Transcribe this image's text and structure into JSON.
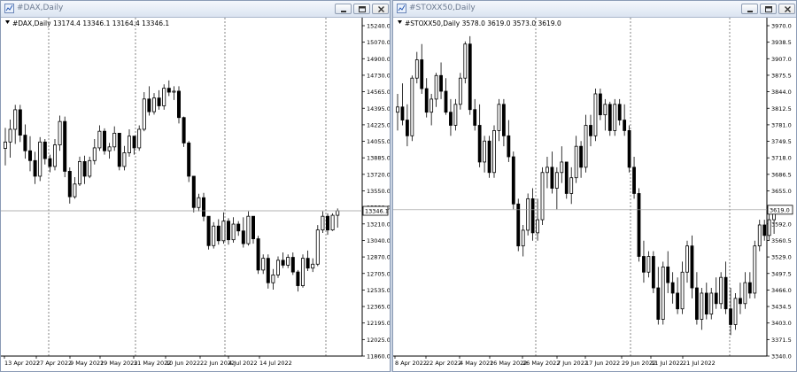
{
  "windows": [
    {
      "title": "#DAX,Daily",
      "info": "#DAX,Daily  13174.4 13346.1 13164.4 13346.1",
      "current_price": "13346.1",
      "y_ticks": [
        "15240.0",
        "15070.0",
        "14900.0",
        "14730.0",
        "14565.0",
        "14395.0",
        "14225.0",
        "14055.0",
        "13885.0",
        "13720.0",
        "13550.0",
        "13380.0",
        "13210.0",
        "13040.0",
        "12870.0",
        "12705.0",
        "12535.0",
        "12365.0",
        "12195.0",
        "12025.0",
        "11860.0"
      ],
      "x_ticks": [
        "13 Apr 2022",
        "27 Apr 2022",
        "9 May 2022",
        "19 May 2022",
        "31 May 2022",
        "10 Jun 2022",
        "22 Jun 2022",
        "4 Jul 2022",
        "14 Jul 2022"
      ]
    },
    {
      "title": "#STOXX50,Daily",
      "info": "#STOXX50,Daily  3578.0 3619.0 3573.0 3619.0",
      "current_price": "3619.0",
      "y_ticks": [
        "3970.0",
        "3938.5",
        "3907.0",
        "3875.5",
        "3844.0",
        "3812.5",
        "3781.0",
        "3749.5",
        "3718.0",
        "3686.5",
        "3655.0",
        "3623.5",
        "3592.0",
        "3560.5",
        "3529.0",
        "3497.5",
        "3466.0",
        "3434.5",
        "3403.0",
        "3371.5",
        "3340.0"
      ],
      "x_ticks": [
        "8 Apr 2022",
        "22 Apr 2022",
        "4 May 2022",
        "16 May 2022",
        "26 May 2022",
        "7 Jun 2022",
        "17 Jun 2022",
        "29 Jun 2022",
        "11 Jul 2022",
        "21 Jul 2022"
      ]
    }
  ],
  "chart_data": [
    {
      "type": "candlestick",
      "title": "#DAX,Daily",
      "ylim": [
        11860,
        15240
      ],
      "ohlc": [
        [
          13985,
          14195,
          13810,
          14050
        ],
        [
          14050,
          14280,
          13890,
          14180
        ],
        [
          14180,
          14430,
          14030,
          14380
        ],
        [
          14380,
          14430,
          14050,
          14120
        ],
        [
          14120,
          14230,
          13880,
          13960
        ],
        [
          13960,
          14110,
          13750,
          13860
        ],
        [
          13860,
          13950,
          13620,
          13700
        ],
        [
          13700,
          14100,
          13650,
          14050
        ],
        [
          14050,
          14080,
          13820,
          13880
        ],
        [
          13880,
          13920,
          13740,
          13800
        ],
        [
          13800,
          14080,
          13760,
          14020
        ],
        [
          14020,
          14320,
          13960,
          14260
        ],
        [
          14260,
          14310,
          13690,
          13750
        ],
        [
          13750,
          13790,
          13420,
          13490
        ],
        [
          13490,
          13690,
          13470,
          13620
        ],
        [
          13620,
          13900,
          13600,
          13850
        ],
        [
          13850,
          13910,
          13620,
          13700
        ],
        [
          13700,
          13900,
          13680,
          13860
        ],
        [
          13860,
          14080,
          13820,
          13990
        ],
        [
          13990,
          14220,
          13960,
          14160
        ],
        [
          14160,
          14190,
          13920,
          13960
        ],
        [
          13960,
          14040,
          13880,
          14000
        ],
        [
          14000,
          14210,
          13960,
          14140
        ],
        [
          14140,
          14060,
          13760,
          13800
        ],
        [
          13800,
          14010,
          13760,
          13940
        ],
        [
          13940,
          14180,
          13900,
          14110
        ],
        [
          14110,
          14080,
          13920,
          13990
        ],
        [
          13990,
          14220,
          13960,
          14180
        ],
        [
          14180,
          14560,
          14160,
          14490
        ],
        [
          14490,
          14620,
          14320,
          14360
        ],
        [
          14360,
          14550,
          14330,
          14500
        ],
        [
          14500,
          14580,
          14380,
          14420
        ],
        [
          14420,
          14640,
          14380,
          14600
        ],
        [
          14600,
          14680,
          14520,
          14560
        ],
        [
          14560,
          14620,
          14480,
          14570
        ],
        [
          14570,
          14620,
          14240,
          14300
        ],
        [
          14300,
          14310,
          14000,
          14040
        ],
        [
          14040,
          14060,
          13640,
          13700
        ],
        [
          13700,
          13660,
          13330,
          13380
        ],
        [
          13380,
          13520,
          13340,
          13480
        ],
        [
          13480,
          13530,
          13240,
          13290
        ],
        [
          13290,
          13280,
          12950,
          12990
        ],
        [
          12990,
          13230,
          12960,
          13190
        ],
        [
          13190,
          13260,
          13000,
          13040
        ],
        [
          13040,
          13330,
          13010,
          13240
        ],
        [
          13240,
          13270,
          13000,
          13050
        ],
        [
          13050,
          13280,
          13020,
          13210
        ],
        [
          13210,
          13240,
          13090,
          13140
        ],
        [
          13140,
          13280,
          12970,
          13010
        ],
        [
          13010,
          13340,
          12990,
          13290
        ],
        [
          13290,
          13280,
          13010,
          13060
        ],
        [
          13060,
          13090,
          12700,
          12740
        ],
        [
          12740,
          12900,
          12700,
          12860
        ],
        [
          12860,
          12900,
          12550,
          12610
        ],
        [
          12610,
          12750,
          12540,
          12690
        ],
        [
          12690,
          12880,
          12660,
          12840
        ],
        [
          12840,
          12920,
          12760,
          12790
        ],
        [
          12790,
          12900,
          12760,
          12870
        ],
        [
          12870,
          12920,
          12690,
          12720
        ],
        [
          12720,
          12740,
          12520,
          12580
        ],
        [
          12580,
          12900,
          12560,
          12860
        ],
        [
          12860,
          12940,
          12730,
          12760
        ],
        [
          12760,
          12860,
          12720,
          12800
        ],
        [
          12800,
          13200,
          12780,
          13150
        ],
        [
          13150,
          13340,
          13120,
          13290
        ],
        [
          13290,
          13320,
          13100,
          13150
        ],
        [
          13150,
          13320,
          13140,
          13300
        ],
        [
          13300,
          13370,
          13174,
          13346
        ]
      ]
    },
    {
      "type": "candlestick",
      "title": "#STOXX50,Daily",
      "ylim": [
        3340,
        3970
      ],
      "ohlc": [
        [
          3805,
          3840,
          3770,
          3815
        ],
        [
          3815,
          3860,
          3780,
          3790
        ],
        [
          3790,
          3820,
          3740,
          3760
        ],
        [
          3760,
          3875,
          3750,
          3870
        ],
        [
          3870,
          3920,
          3860,
          3905
        ],
        [
          3905,
          3935,
          3840,
          3850
        ],
        [
          3850,
          3870,
          3795,
          3805
        ],
        [
          3805,
          3840,
          3780,
          3830
        ],
        [
          3830,
          3880,
          3815,
          3875
        ],
        [
          3875,
          3900,
          3830,
          3845
        ],
        [
          3845,
          3870,
          3800,
          3805
        ],
        [
          3805,
          3830,
          3760,
          3780
        ],
        [
          3780,
          3830,
          3770,
          3820
        ],
        [
          3820,
          3880,
          3810,
          3870
        ],
        [
          3870,
          3940,
          3860,
          3935
        ],
        [
          3935,
          3950,
          3800,
          3810
        ],
        [
          3810,
          3830,
          3770,
          3780
        ],
        [
          3780,
          3820,
          3700,
          3710
        ],
        [
          3710,
          3760,
          3690,
          3750
        ],
        [
          3750,
          3760,
          3680,
          3690
        ],
        [
          3690,
          3780,
          3680,
          3770
        ],
        [
          3770,
          3830,
          3750,
          3820
        ],
        [
          3820,
          3830,
          3740,
          3760
        ],
        [
          3760,
          3790,
          3710,
          3720
        ],
        [
          3720,
          3730,
          3620,
          3630
        ],
        [
          3630,
          3640,
          3540,
          3550
        ],
        [
          3550,
          3590,
          3530,
          3580
        ],
        [
          3580,
          3650,
          3570,
          3640
        ],
        [
          3640,
          3660,
          3560,
          3575
        ],
        [
          3575,
          3640,
          3560,
          3600
        ],
        [
          3600,
          3700,
          3590,
          3690
        ],
        [
          3690,
          3720,
          3660,
          3700
        ],
        [
          3700,
          3730,
          3650,
          3660
        ],
        [
          3660,
          3700,
          3620,
          3690
        ],
        [
          3690,
          3740,
          3670,
          3710
        ],
        [
          3710,
          3700,
          3640,
          3650
        ],
        [
          3650,
          3700,
          3630,
          3680
        ],
        [
          3680,
          3760,
          3670,
          3740
        ],
        [
          3740,
          3750,
          3680,
          3700
        ],
        [
          3700,
          3800,
          3690,
          3780
        ],
        [
          3780,
          3800,
          3740,
          3760
        ],
        [
          3760,
          3850,
          3750,
          3840
        ],
        [
          3840,
          3850,
          3790,
          3800
        ],
        [
          3800,
          3830,
          3770,
          3820
        ],
        [
          3820,
          3825,
          3760,
          3770
        ],
        [
          3770,
          3830,
          3760,
          3820
        ],
        [
          3820,
          3830,
          3780,
          3790
        ],
        [
          3790,
          3820,
          3760,
          3770
        ],
        [
          3770,
          3780,
          3690,
          3700
        ],
        [
          3700,
          3720,
          3640,
          3650
        ],
        [
          3650,
          3660,
          3520,
          3530
        ],
        [
          3530,
          3560,
          3480,
          3500
        ],
        [
          3500,
          3540,
          3490,
          3530
        ],
        [
          3530,
          3540,
          3460,
          3470
        ],
        [
          3470,
          3510,
          3400,
          3410
        ],
        [
          3410,
          3520,
          3400,
          3510
        ],
        [
          3510,
          3540,
          3460,
          3480
        ],
        [
          3480,
          3500,
          3440,
          3460
        ],
        [
          3460,
          3490,
          3420,
          3430
        ],
        [
          3430,
          3520,
          3420,
          3500
        ],
        [
          3500,
          3560,
          3480,
          3550
        ],
        [
          3550,
          3570,
          3450,
          3470
        ],
        [
          3470,
          3500,
          3400,
          3410
        ],
        [
          3410,
          3470,
          3390,
          3460
        ],
        [
          3460,
          3480,
          3410,
          3420
        ],
        [
          3420,
          3470,
          3410,
          3460
        ],
        [
          3460,
          3490,
          3430,
          3440
        ],
        [
          3440,
          3500,
          3430,
          3490
        ],
        [
          3490,
          3520,
          3420,
          3430
        ],
        [
          3430,
          3470,
          3380,
          3400
        ],
        [
          3400,
          3460,
          3390,
          3450
        ],
        [
          3450,
          3480,
          3420,
          3440
        ],
        [
          3440,
          3500,
          3430,
          3480
        ],
        [
          3480,
          3500,
          3450,
          3460
        ],
        [
          3460,
          3560,
          3450,
          3550
        ],
        [
          3550,
          3600,
          3540,
          3590
        ],
        [
          3590,
          3600,
          3560,
          3570
        ],
        [
          3570,
          3620,
          3560,
          3600
        ],
        [
          3600,
          3620,
          3573,
          3619
        ]
      ]
    }
  ]
}
